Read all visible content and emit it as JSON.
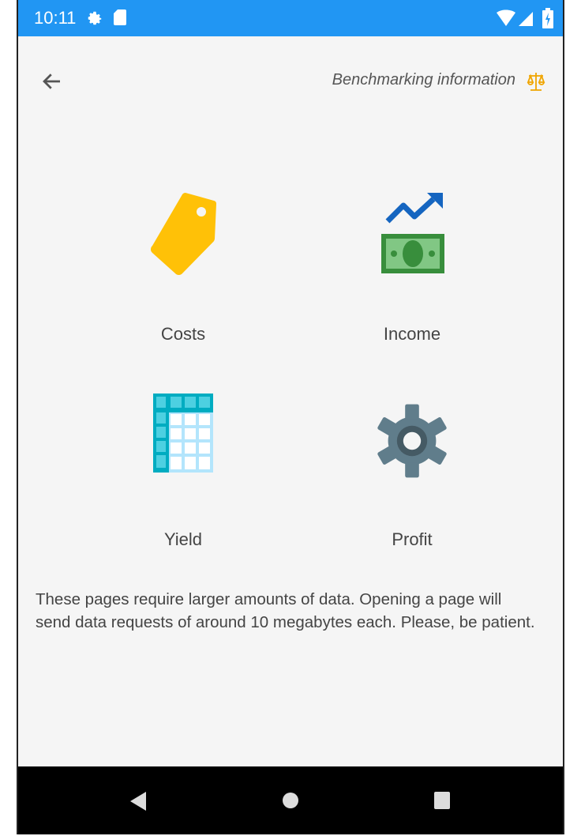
{
  "status_bar": {
    "time": "10:11",
    "icons": [
      "gear-icon",
      "sd-card-icon",
      "wifi-icon",
      "signal-icon",
      "battery-icon"
    ],
    "color": "#2196f3"
  },
  "header": {
    "back_icon": "arrow-left-icon",
    "title": "Benchmarking information",
    "title_icon": "balance-scale-icon"
  },
  "tiles": [
    {
      "label": "Costs",
      "icon": "price-tag-icon",
      "color": "#ffc107"
    },
    {
      "label": "Income",
      "icon": "money-trend-icon",
      "color": "#388e3c"
    },
    {
      "label": "Yield",
      "icon": "table-grid-icon",
      "color": "#00acc1"
    },
    {
      "label": "Profit",
      "icon": "gear-icon",
      "color": "#607d8b"
    }
  ],
  "notice": "These pages require larger amounts of data. Opening a page will send data requests of around 10 megabytes each. Please, be patient.",
  "nav_bar": {
    "icons": [
      "nav-back-icon",
      "nav-home-icon",
      "nav-recents-icon"
    ]
  }
}
